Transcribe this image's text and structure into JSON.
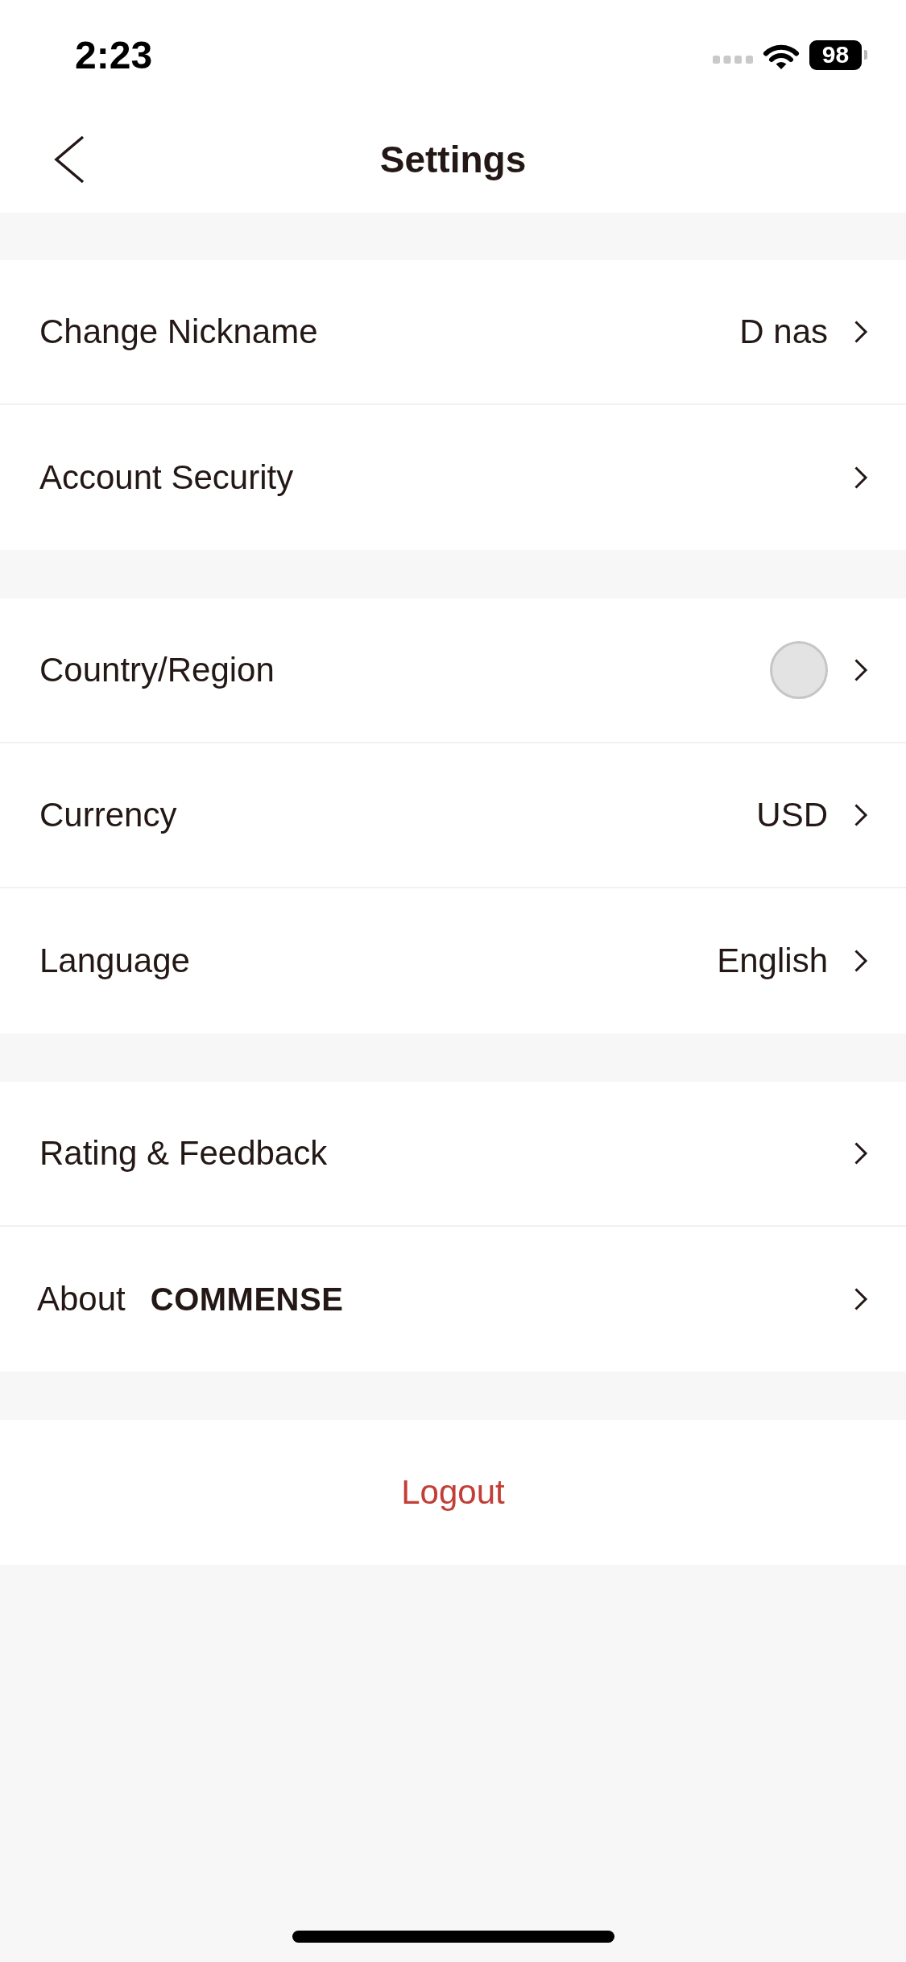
{
  "status_bar": {
    "time": "2:23",
    "battery": "98"
  },
  "nav_bar": {
    "title": "Settings"
  },
  "sections": [
    {
      "rows": [
        {
          "kind": "value",
          "label": "Change Nickname",
          "value": "D nas"
        },
        {
          "kind": "plain",
          "label": "Account Security"
        }
      ]
    },
    {
      "rows": [
        {
          "kind": "flag",
          "label": "Country/Region"
        },
        {
          "kind": "value",
          "label": "Currency",
          "value": "USD"
        },
        {
          "kind": "value",
          "label": "Language",
          "value": "English"
        }
      ]
    },
    {
      "rows": [
        {
          "kind": "plain",
          "label": "Rating & Feedback"
        },
        {
          "kind": "logo",
          "label": "About",
          "logo": "COMMENSE"
        }
      ]
    }
  ],
  "logout": {
    "label": "Logout"
  }
}
